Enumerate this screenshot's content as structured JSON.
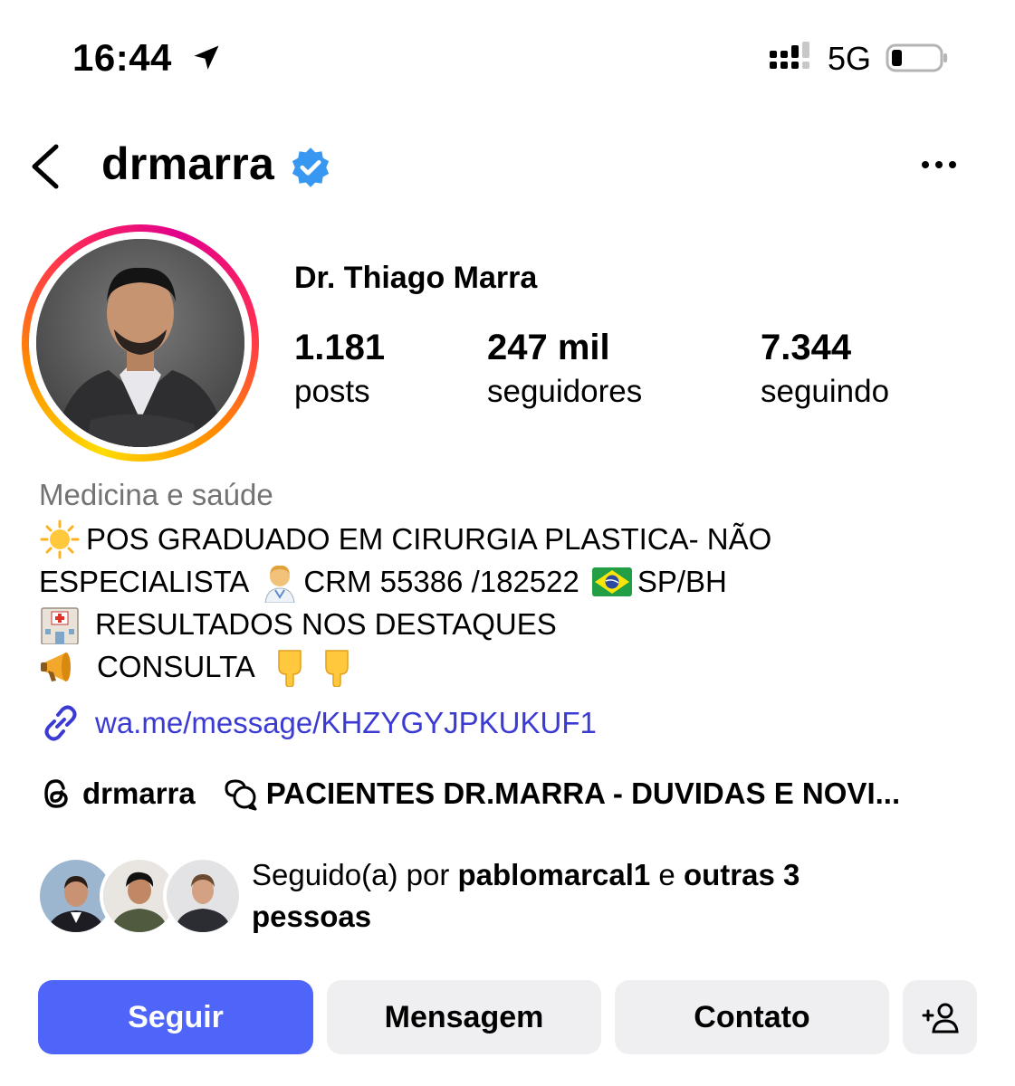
{
  "status_bar": {
    "time": "16:44",
    "network": "5G"
  },
  "header": {
    "username": "drmarra",
    "verified": true
  },
  "profile": {
    "full_name": "Dr. Thiago Marra",
    "stats": [
      {
        "value": "1.181",
        "label": "posts"
      },
      {
        "value": "247 mil",
        "label": "seguidores"
      },
      {
        "value": "7.344",
        "label": "seguindo"
      }
    ],
    "category": "Medicina e saúde",
    "bio": {
      "line1": "POS GRADUADO EM CIRURGIA PLASTICA- NÃO",
      "line2a": "ESPECIALISTA",
      "line2b": "CRM 55386 /182522",
      "line2c": "SP/BH",
      "line3": "RESULTADOS NOS DESTAQUES",
      "line4": "CONSULTA"
    },
    "link": "wa.me/message/KHZYGYJPKUKUF1",
    "threads_handle": "drmarra",
    "channel": "PACIENTES DR.MARRA - DUVIDAS E NOVI..."
  },
  "followed_by": {
    "prefix": "Seguido(a) por ",
    "user": "pablomarcal1",
    "middle": " e ",
    "others": "outras 3",
    "suffix": "pessoas"
  },
  "actions": {
    "follow": "Seguir",
    "message": "Mensagem",
    "contact": "Contato"
  },
  "colors": {
    "accent": "#4f64f8",
    "link": "#3b3bd4",
    "verified": "#3897f0",
    "muted": "#737373",
    "button_bg": "#efeff1"
  }
}
